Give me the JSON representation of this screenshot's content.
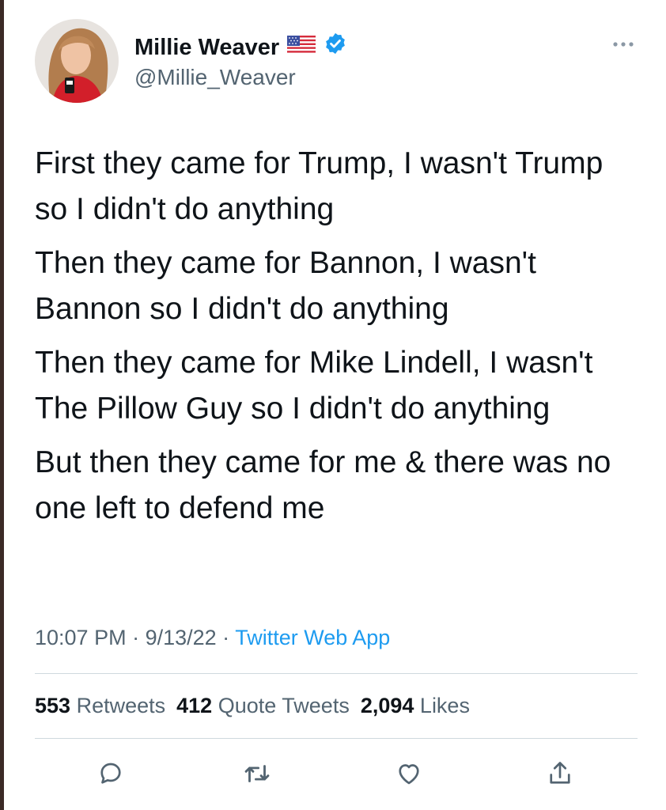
{
  "author": {
    "display_name": "Millie Weaver",
    "handle": "@Millie_Weaver",
    "name_emoji": "us-flag-icon",
    "verified": true
  },
  "tweet": {
    "paragraphs": [
      "First they came for Trump, I wasn't Trump so I didn't do anything",
      "Then they came for Bannon, I wasn't Bannon so I didn't do anything",
      "Then they came for Mike Lindell, I wasn't The Pillow Guy so I didn't do anything",
      "But then they came for me & there was no one left to defend me"
    ]
  },
  "meta": {
    "time": "10:07 PM",
    "sep1": " · ",
    "date": "9/13/22",
    "sep2": " · ",
    "source": "Twitter Web App"
  },
  "stats": {
    "retweets_count": "553",
    "retweets_label": "Retweets",
    "quotes_count": "412",
    "quotes_label": "Quote Tweets",
    "likes_count": "2,094",
    "likes_label": "Likes"
  },
  "actions": [
    "reply-icon",
    "retweet-icon",
    "like-icon",
    "share-icon"
  ],
  "colors": {
    "text": "#0f1419",
    "secondary": "#536471",
    "accent": "#1d9bf0",
    "divider": "#cfd9de"
  }
}
